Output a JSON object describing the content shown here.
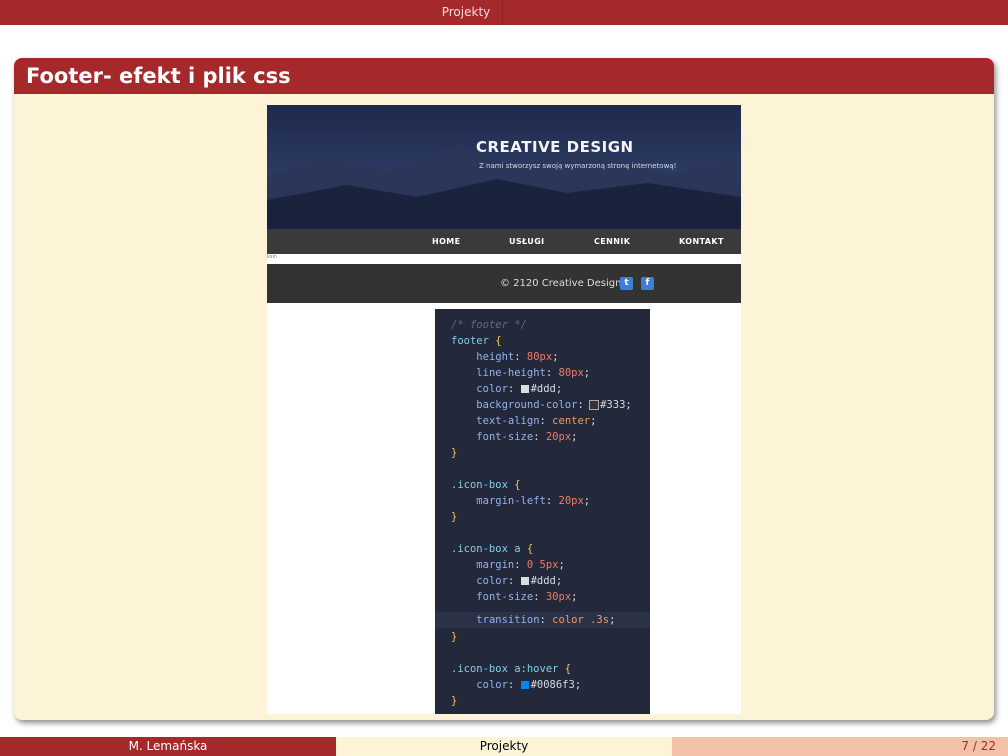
{
  "header": {
    "section": "Projekty"
  },
  "frame": {
    "title": "Footer- efekt i plik css"
  },
  "screenshot": {
    "hero_title": "CREATIVE DESIGN",
    "hero_subtitle": "Z nami stworzysz swoją wymarzoną stronę internetową!",
    "nav": [
      "HOME",
      "USŁUGI",
      "CENNIK",
      "KONTAKT"
    ],
    "strip_text": "ksin",
    "footer_text": "© 2120 Creative Design",
    "footer_icons": [
      "twitter-icon",
      "facebook-icon"
    ]
  },
  "code_lines": [
    "/* footer */",
    "footer {",
    "    height: 80px;",
    "    line-height: 80px;",
    "    color: #ddd;",
    "    background-color: #333;",
    "    text-align: center;",
    "    font-size: 20px;",
    "}",
    "",
    ".icon-box {",
    "    margin-left: 20px;",
    "}",
    "",
    ".icon-box a {",
    "    margin: 0 5px;",
    "    color: #ddd;",
    "    font-size: 30px;",
    "    transition: color .3s;",
    "}",
    "",
    ".icon-box a:hover {",
    "    color: #0086f3;",
    "}"
  ],
  "colors": {
    "accent": "#a5292b",
    "block_bg": "#fdf4d8",
    "swatch_ddd": "#dddddd",
    "swatch_333": "#333333",
    "swatch_hover": "#0086f3"
  },
  "footer": {
    "author": "M. Lemańska",
    "title": "Projekty",
    "page": "7 / 22"
  }
}
